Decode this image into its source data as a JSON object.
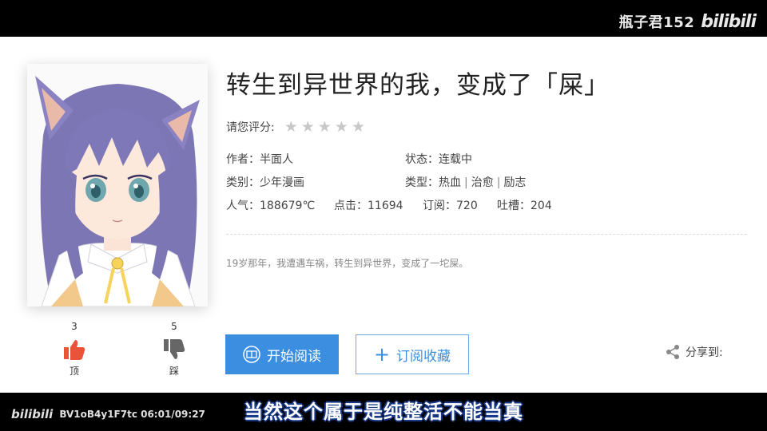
{
  "watermark": {
    "user": "瓶子君152",
    "logo": "bilibili"
  },
  "comic": {
    "title": "转生到异世界的我，变成了「屎」",
    "rating_label": "请您评分:",
    "rating_stars": "★★★★★",
    "author": "作者：半面人",
    "status": "状态：连载中",
    "category": "类别：少年漫画",
    "genre_prefix": "类型：",
    "genres": [
      "热血",
      "治愈",
      "励志"
    ],
    "genre_separator": "|",
    "popularity": "人气：188679℃",
    "clicks": "点击：11694",
    "subscriptions": "订阅：720",
    "comments": "吐槽：204",
    "description": "19岁那年，我遭遇车祸，转生到异世界，变成了一坨屎。"
  },
  "votes": {
    "up_count": "3",
    "up_label": "顶",
    "down_count": "5",
    "down_label": "踩"
  },
  "actions": {
    "read_label": "开始阅读",
    "favorite_label": "订阅收藏",
    "share_label": "分享到:"
  },
  "video": {
    "logo": "bilibili",
    "info": "BV1oB4y1F7tc 06:01/09:27",
    "subtitle": "当然这个属于是纯整活不能当真"
  },
  "colors": {
    "accent": "#3c8fe0",
    "vote": "#e8533a"
  }
}
